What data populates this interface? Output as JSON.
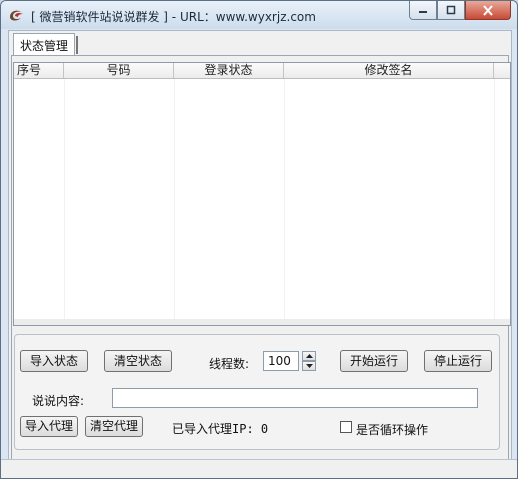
{
  "window": {
    "title": "[ 微营销软件站说说群发 ] - URL：www.wyxrjz.com"
  },
  "tabs": [
    {
      "label": "状态管理"
    }
  ],
  "table": {
    "columns": [
      "序号",
      "号码",
      "登录状态",
      "修改签名",
      ""
    ],
    "rows": []
  },
  "controls": {
    "import_status": "导入状态",
    "clear_status": "清空状态",
    "thread_label": "线程数:",
    "thread_value": "100",
    "start_button": "开始运行",
    "stop_button": "停止运行",
    "content_label": "说说内容:",
    "content_value": "",
    "import_proxy": "导入代理",
    "clear_proxy": "清空代理",
    "proxy_imported_label": "已导入代理IP: 0",
    "loop_label": "是否循环操作",
    "loop_checked": false
  },
  "icons": [
    "app-icon",
    "minimize-icon",
    "maximize-icon",
    "close-icon",
    "spin-up-icon",
    "spin-down-icon"
  ]
}
